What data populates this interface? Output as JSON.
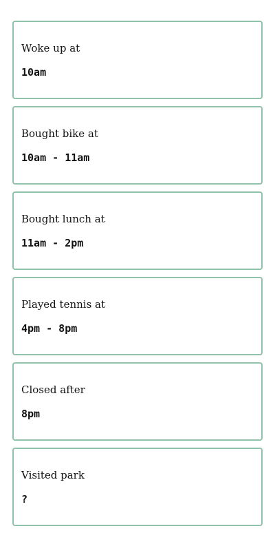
{
  "cards": [
    {
      "label": "Woke up at",
      "value": "10am"
    },
    {
      "label": "Bought bike at",
      "value": "10am - 11am"
    },
    {
      "label": "Bought lunch at",
      "value": "11am - 2pm"
    },
    {
      "label": "Played tennis at",
      "value": "4pm - 8pm"
    },
    {
      "label": "Closed after",
      "value": "8pm"
    },
    {
      "label": "Visited park",
      "value": "?"
    }
  ],
  "colors": {
    "card_border": "#8fc1ab",
    "text": "#111111",
    "background": "#ffffff"
  }
}
